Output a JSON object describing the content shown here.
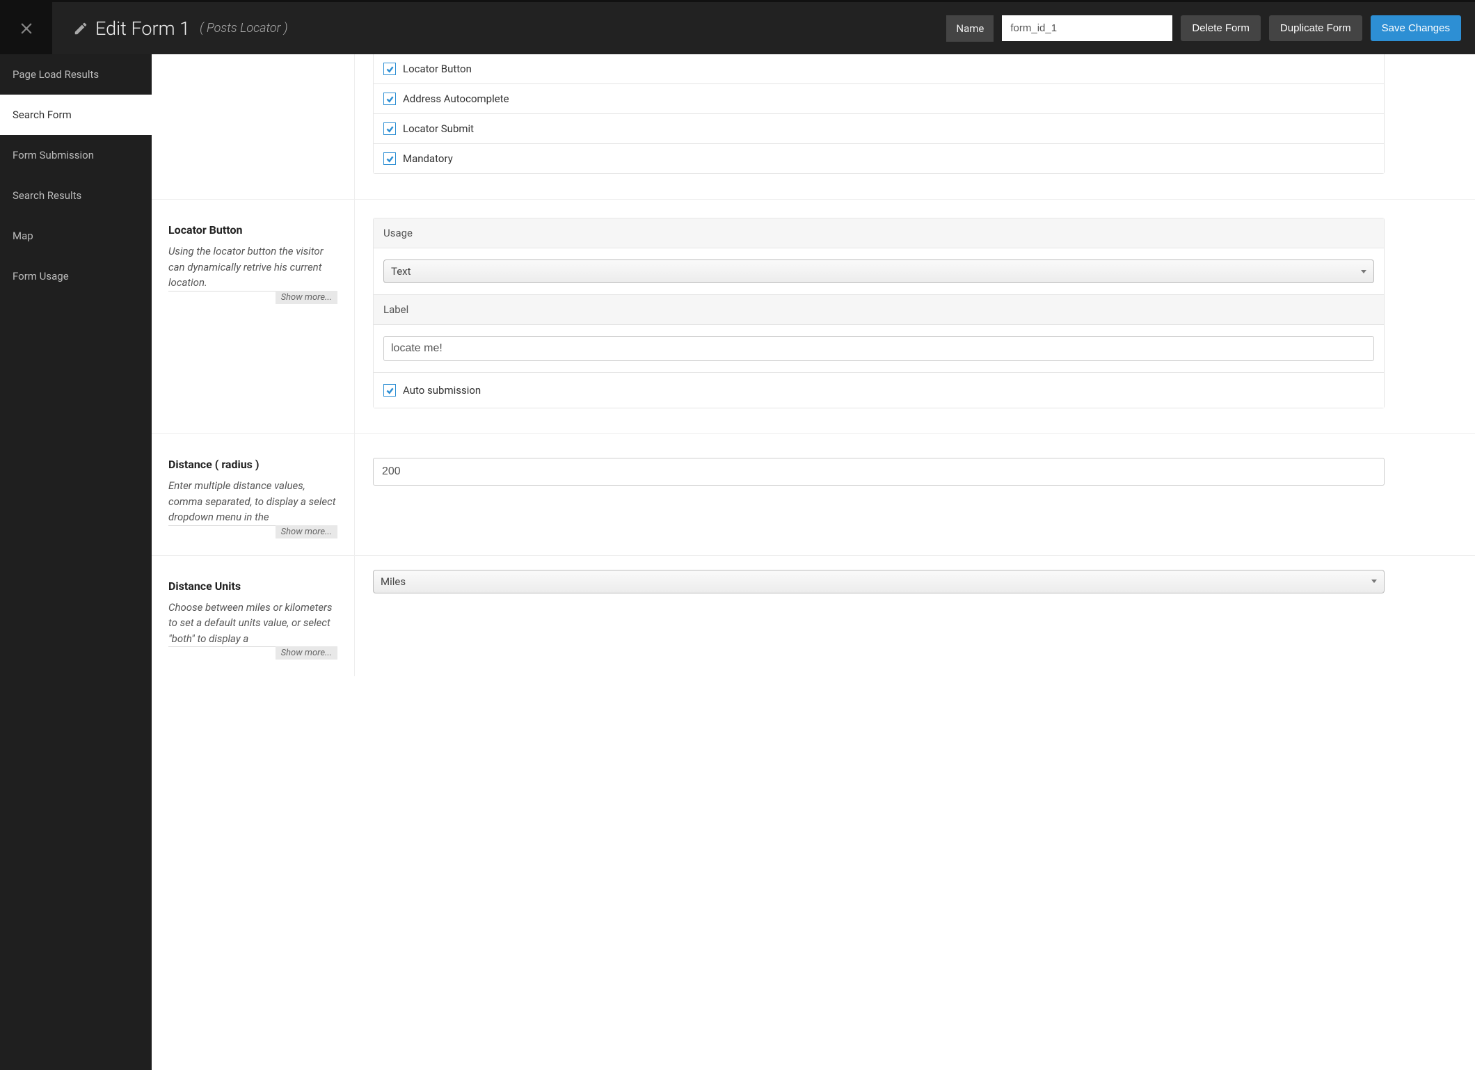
{
  "header": {
    "title": "Edit Form 1",
    "subtitle": "( Posts Locator )",
    "name_label": "Name",
    "name_value": "form_id_1",
    "delete_label": "Delete Form",
    "duplicate_label": "Duplicate Form",
    "save_label": "Save Changes"
  },
  "sidebar": {
    "items": [
      {
        "label": "Page Load Results"
      },
      {
        "label": "Search Form"
      },
      {
        "label": "Form Submission"
      },
      {
        "label": "Search Results"
      },
      {
        "label": "Map"
      },
      {
        "label": "Form Usage"
      }
    ]
  },
  "checkboxes_top": [
    {
      "label": "Locator Button"
    },
    {
      "label": "Address Autocomplete"
    },
    {
      "label": "Locator Submit"
    },
    {
      "label": "Mandatory"
    }
  ],
  "locator": {
    "title": "Locator Button",
    "desc": "Using the locator button the visitor can dynamically retrive his current location.",
    "showmore": "Show more...",
    "usage_label": "Usage",
    "usage_value": "Text",
    "label_label": "Label",
    "label_value": "locate me!",
    "auto_label": "Auto submission"
  },
  "distance": {
    "title": "Distance ( radius )",
    "desc": "Enter multiple distance values, comma separated, to display a select dropdown menu in the",
    "showmore": "Show more...",
    "value": "200"
  },
  "units": {
    "title": "Distance Units",
    "desc": "Choose between miles or kilometers to set a default units value, or select \"both\" to display a",
    "showmore": "Show more...",
    "value": "Miles"
  }
}
